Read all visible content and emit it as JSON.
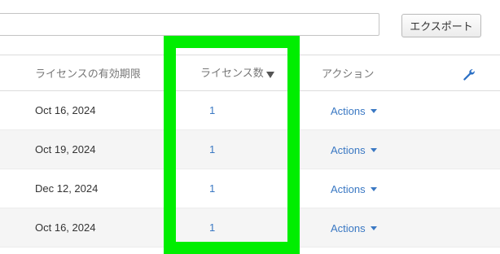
{
  "toolbar": {
    "search_value": "",
    "export_label": "エクスポート"
  },
  "table": {
    "headers": {
      "expiry": "ライセンスの有効期限",
      "count": "ライセンス数",
      "action": "アクション"
    },
    "rows": [
      {
        "expiry": "Oct 16, 2024",
        "count": "1",
        "action": "Actions"
      },
      {
        "expiry": "Oct 19, 2024",
        "count": "1",
        "action": "Actions"
      },
      {
        "expiry": "Dec 12, 2024",
        "count": "1",
        "action": "Actions"
      },
      {
        "expiry": "Oct 16, 2024",
        "count": "1",
        "action": "Actions"
      }
    ]
  },
  "icons": {
    "sort": "sort-desc-icon",
    "settings": "wrench-icon",
    "dropdown": "caret-down-icon"
  },
  "colors": {
    "link": "#3a78c3",
    "highlight": "#00ee00",
    "wrench": "#2a6fc4"
  }
}
